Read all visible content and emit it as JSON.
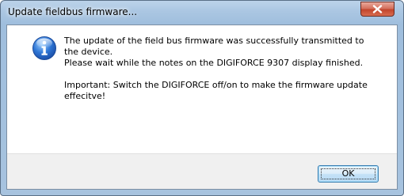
{
  "window": {
    "title": "Update fieldbus firmware...",
    "close_icon": "close-icon"
  },
  "dialog": {
    "icon": "info-icon",
    "message_line1": "The update of the field bus firmware was successfully transmitted to\nthe device.\nPlease wait while the notes on the DIGIFORCE 9307 display finished.",
    "message_line2": "Important: Switch the DIGIFORCE off/on to make the firmware update\neffecitve!"
  },
  "buttons": {
    "ok_label": "OK"
  },
  "colors": {
    "frame": "#a7c3df",
    "close_button": "#c2452c",
    "ok_button_border": "#3c7fb1",
    "footer": "#f0f0f0"
  }
}
